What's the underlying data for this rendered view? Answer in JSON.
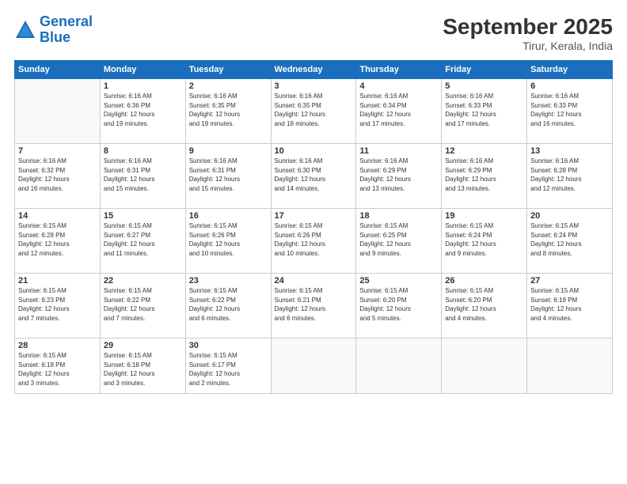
{
  "header": {
    "logo_line1": "General",
    "logo_line2": "Blue",
    "month": "September 2025",
    "location": "Tirur, Kerala, India"
  },
  "weekdays": [
    "Sunday",
    "Monday",
    "Tuesday",
    "Wednesday",
    "Thursday",
    "Friday",
    "Saturday"
  ],
  "weeks": [
    [
      {
        "day": null,
        "info": null
      },
      {
        "day": "1",
        "info": "Sunrise: 6:16 AM\nSunset: 6:36 PM\nDaylight: 12 hours\nand 19 minutes."
      },
      {
        "day": "2",
        "info": "Sunrise: 6:16 AM\nSunset: 6:35 PM\nDaylight: 12 hours\nand 19 minutes."
      },
      {
        "day": "3",
        "info": "Sunrise: 6:16 AM\nSunset: 6:35 PM\nDaylight: 12 hours\nand 18 minutes."
      },
      {
        "day": "4",
        "info": "Sunrise: 6:16 AM\nSunset: 6:34 PM\nDaylight: 12 hours\nand 17 minutes."
      },
      {
        "day": "5",
        "info": "Sunrise: 6:16 AM\nSunset: 6:33 PM\nDaylight: 12 hours\nand 17 minutes."
      },
      {
        "day": "6",
        "info": "Sunrise: 6:16 AM\nSunset: 6:33 PM\nDaylight: 12 hours\nand 16 minutes."
      }
    ],
    [
      {
        "day": "7",
        "info": "Sunrise: 6:16 AM\nSunset: 6:32 PM\nDaylight: 12 hours\nand 16 minutes."
      },
      {
        "day": "8",
        "info": "Sunrise: 6:16 AM\nSunset: 6:31 PM\nDaylight: 12 hours\nand 15 minutes."
      },
      {
        "day": "9",
        "info": "Sunrise: 6:16 AM\nSunset: 6:31 PM\nDaylight: 12 hours\nand 15 minutes."
      },
      {
        "day": "10",
        "info": "Sunrise: 6:16 AM\nSunset: 6:30 PM\nDaylight: 12 hours\nand 14 minutes."
      },
      {
        "day": "11",
        "info": "Sunrise: 6:16 AM\nSunset: 6:29 PM\nDaylight: 12 hours\nand 13 minutes."
      },
      {
        "day": "12",
        "info": "Sunrise: 6:16 AM\nSunset: 6:29 PM\nDaylight: 12 hours\nand 13 minutes."
      },
      {
        "day": "13",
        "info": "Sunrise: 6:16 AM\nSunset: 6:28 PM\nDaylight: 12 hours\nand 12 minutes."
      }
    ],
    [
      {
        "day": "14",
        "info": "Sunrise: 6:15 AM\nSunset: 6:28 PM\nDaylight: 12 hours\nand 12 minutes."
      },
      {
        "day": "15",
        "info": "Sunrise: 6:15 AM\nSunset: 6:27 PM\nDaylight: 12 hours\nand 11 minutes."
      },
      {
        "day": "16",
        "info": "Sunrise: 6:15 AM\nSunset: 6:26 PM\nDaylight: 12 hours\nand 10 minutes."
      },
      {
        "day": "17",
        "info": "Sunrise: 6:15 AM\nSunset: 6:26 PM\nDaylight: 12 hours\nand 10 minutes."
      },
      {
        "day": "18",
        "info": "Sunrise: 6:15 AM\nSunset: 6:25 PM\nDaylight: 12 hours\nand 9 minutes."
      },
      {
        "day": "19",
        "info": "Sunrise: 6:15 AM\nSunset: 6:24 PM\nDaylight: 12 hours\nand 9 minutes."
      },
      {
        "day": "20",
        "info": "Sunrise: 6:15 AM\nSunset: 6:24 PM\nDaylight: 12 hours\nand 8 minutes."
      }
    ],
    [
      {
        "day": "21",
        "info": "Sunrise: 6:15 AM\nSunset: 6:23 PM\nDaylight: 12 hours\nand 7 minutes."
      },
      {
        "day": "22",
        "info": "Sunrise: 6:15 AM\nSunset: 6:22 PM\nDaylight: 12 hours\nand 7 minutes."
      },
      {
        "day": "23",
        "info": "Sunrise: 6:15 AM\nSunset: 6:22 PM\nDaylight: 12 hours\nand 6 minutes."
      },
      {
        "day": "24",
        "info": "Sunrise: 6:15 AM\nSunset: 6:21 PM\nDaylight: 12 hours\nand 6 minutes."
      },
      {
        "day": "25",
        "info": "Sunrise: 6:15 AM\nSunset: 6:20 PM\nDaylight: 12 hours\nand 5 minutes."
      },
      {
        "day": "26",
        "info": "Sunrise: 6:15 AM\nSunset: 6:20 PM\nDaylight: 12 hours\nand 4 minutes."
      },
      {
        "day": "27",
        "info": "Sunrise: 6:15 AM\nSunset: 6:19 PM\nDaylight: 12 hours\nand 4 minutes."
      }
    ],
    [
      {
        "day": "28",
        "info": "Sunrise: 6:15 AM\nSunset: 6:18 PM\nDaylight: 12 hours\nand 3 minutes."
      },
      {
        "day": "29",
        "info": "Sunrise: 6:15 AM\nSunset: 6:18 PM\nDaylight: 12 hours\nand 3 minutes."
      },
      {
        "day": "30",
        "info": "Sunrise: 6:15 AM\nSunset: 6:17 PM\nDaylight: 12 hours\nand 2 minutes."
      },
      {
        "day": null,
        "info": null
      },
      {
        "day": null,
        "info": null
      },
      {
        "day": null,
        "info": null
      },
      {
        "day": null,
        "info": null
      }
    ]
  ]
}
